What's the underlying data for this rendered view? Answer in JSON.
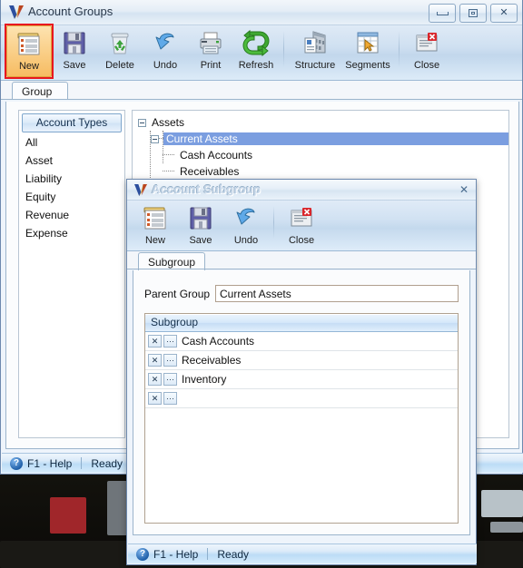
{
  "main_window": {
    "title": "Account Groups",
    "logo": "v-logo-icon",
    "window_buttons": [
      {
        "name": "minimize-button",
        "glyph": "minimize-icon"
      },
      {
        "name": "maximize-button",
        "glyph": "maximize-icon"
      },
      {
        "name": "close-button",
        "glyph": "✕"
      }
    ],
    "toolbar": [
      {
        "label": "New",
        "icon": "new-document-icon",
        "selected": true,
        "highlighted": true
      },
      {
        "label": "Save",
        "icon": "floppy-disk-icon",
        "selected": false
      },
      {
        "label": "Delete",
        "icon": "recycle-bin-icon",
        "selected": false
      },
      {
        "label": "Undo",
        "icon": "undo-arrow-icon",
        "selected": false
      },
      {
        "label": "Print",
        "icon": "printer-icon",
        "selected": false
      },
      {
        "label": "Refresh",
        "icon": "refresh-arrows-icon",
        "selected": false
      },
      {
        "separator": true
      },
      {
        "label": "Structure",
        "icon": "building-structure-icon",
        "selected": false
      },
      {
        "label": "Segments",
        "icon": "segments-grid-icon",
        "selected": false
      },
      {
        "separator": true
      },
      {
        "label": "Close",
        "icon": "close-window-icon",
        "selected": false
      }
    ],
    "tabs": [
      {
        "label": "Group",
        "active": true
      }
    ],
    "account_types": {
      "header": "Account Types",
      "items": [
        "All",
        "Asset",
        "Liability",
        "Equity",
        "Revenue",
        "Expense"
      ]
    },
    "tree": [
      {
        "label": "Assets",
        "level": 0,
        "expander": "collapse-icon",
        "selected": false
      },
      {
        "label": "Current Assets",
        "level": 1,
        "expander": "collapse-icon",
        "selected": true
      },
      {
        "label": "Cash Accounts",
        "level": 2,
        "expander": null,
        "selected": false
      },
      {
        "label": "Receivables",
        "level": 2,
        "expander": null,
        "selected": false
      }
    ],
    "statusbar": {
      "help_icon": "?",
      "help_label": "F1 - Help",
      "status": "Ready"
    }
  },
  "sub_window": {
    "title": "Account Subgroup",
    "logo": "v-logo-icon",
    "close_glyph": "✕",
    "toolbar": [
      {
        "label": "New",
        "icon": "new-document-icon"
      },
      {
        "label": "Save",
        "icon": "floppy-disk-icon"
      },
      {
        "label": "Undo",
        "icon": "undo-arrow-icon"
      },
      {
        "separator": true
      },
      {
        "label": "Close",
        "icon": "close-window-icon"
      }
    ],
    "tabs": [
      {
        "label": "Subgroup",
        "active": true
      }
    ],
    "parent_group": {
      "label": "Parent Group",
      "value": "Current Assets",
      "placeholder": ""
    },
    "grid": {
      "header": "Subgroup",
      "delete_glyph": "✕",
      "browse_glyph": "···",
      "rows": [
        {
          "name": "Cash Accounts"
        },
        {
          "name": "Receivables"
        },
        {
          "name": "Inventory"
        },
        {
          "name": ""
        }
      ]
    },
    "statusbar": {
      "help_icon": "?",
      "help_label": "F1 - Help",
      "status": "Ready"
    }
  },
  "colors": {
    "accent": "#7b9ee0",
    "highlight_ring": "#e8171f",
    "selected_button": "#f7bc62",
    "titlebar": "#e4edf6"
  }
}
